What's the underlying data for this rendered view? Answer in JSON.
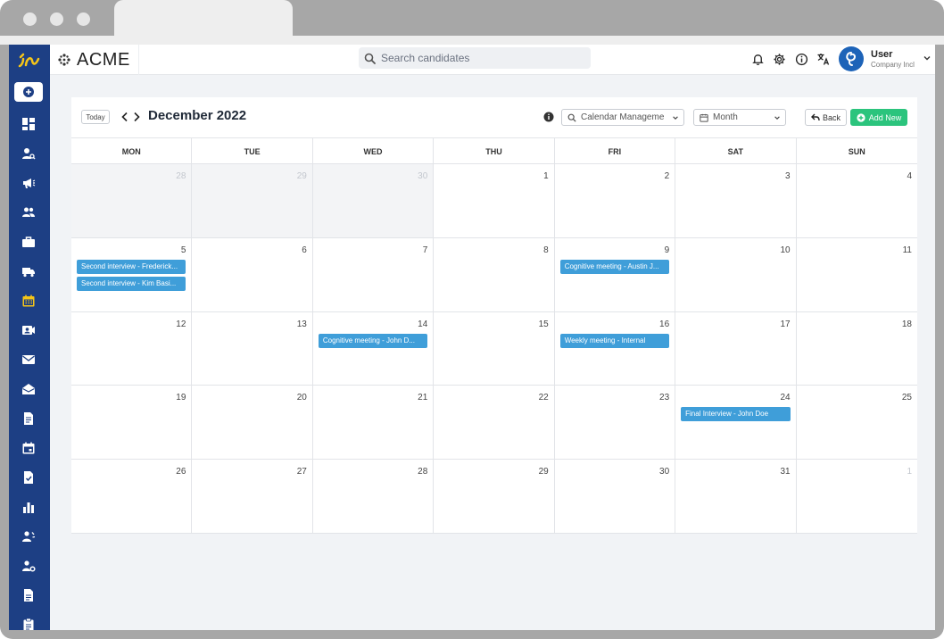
{
  "brand": {
    "name": "ACME"
  },
  "search": {
    "placeholder": "Search candidates"
  },
  "user": {
    "name": "User",
    "company": "Company Incl"
  },
  "sidebar": {
    "icons": [
      "add-icon",
      "dashboard-icon",
      "candidate-search-icon",
      "campaign-icon",
      "people-icon",
      "briefcase-icon",
      "truck-icon",
      "calendar-icon",
      "contact-card-icon",
      "mail-icon",
      "open-mail-icon",
      "document-icon",
      "event-icon",
      "checklist-icon",
      "chart-icon",
      "team-icon",
      "user-settings-icon",
      "file-icon",
      "clipboard-icon"
    ]
  },
  "toolbar": {
    "today_label": "Today",
    "title": "December 2022",
    "calendar_select": "Calendar Manageme",
    "view_select": "Month",
    "back_label": "Back",
    "add_label": "Add New"
  },
  "calendar": {
    "weekdays": [
      "MON",
      "TUE",
      "WED",
      "THU",
      "FRI",
      "SAT",
      "SUN"
    ],
    "days": [
      {
        "n": "28",
        "other": true
      },
      {
        "n": "29",
        "other": true
      },
      {
        "n": "30",
        "other": true
      },
      {
        "n": "1"
      },
      {
        "n": "2"
      },
      {
        "n": "3"
      },
      {
        "n": "4"
      },
      {
        "n": "5",
        "events": [
          "Second interview - Frederick...",
          "Second interview - Kim Basi..."
        ]
      },
      {
        "n": "6"
      },
      {
        "n": "7"
      },
      {
        "n": "8"
      },
      {
        "n": "9",
        "events": [
          "Cognitive meeting - Austin J..."
        ]
      },
      {
        "n": "10"
      },
      {
        "n": "11"
      },
      {
        "n": "12"
      },
      {
        "n": "13"
      },
      {
        "n": "14",
        "events": [
          "Cognitive meeting - John D..."
        ]
      },
      {
        "n": "15"
      },
      {
        "n": "16",
        "events": [
          "Weekly meeting - Internal"
        ]
      },
      {
        "n": "17"
      },
      {
        "n": "18"
      },
      {
        "n": "19"
      },
      {
        "n": "20"
      },
      {
        "n": "21"
      },
      {
        "n": "22"
      },
      {
        "n": "23"
      },
      {
        "n": "24",
        "events": [
          "Final Interview - John Doe"
        ]
      },
      {
        "n": "25"
      },
      {
        "n": "26"
      },
      {
        "n": "27"
      },
      {
        "n": "28"
      },
      {
        "n": "29"
      },
      {
        "n": "30"
      },
      {
        "n": "31"
      },
      {
        "n": "1",
        "other": true,
        "plain": true
      }
    ]
  },
  "colors": {
    "sidebar": "#1d3f84",
    "event": "#3f9ed9",
    "add_button": "#2bc47d",
    "logo_accent": "#f5c518"
  }
}
